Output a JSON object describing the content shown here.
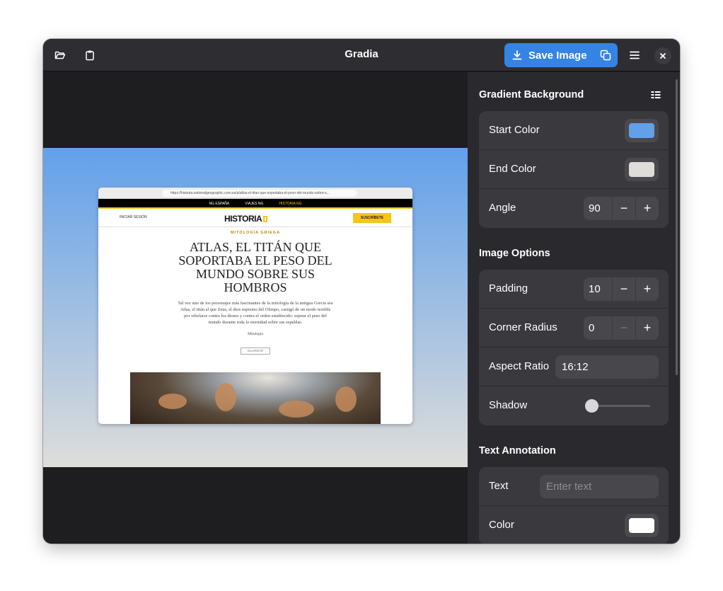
{
  "app": {
    "title": "Gradia"
  },
  "header": {
    "open_icon": "folder-open-icon",
    "paste_icon": "clipboard-icon",
    "save_label": "Save Image",
    "copy_icon": "copy-icon",
    "menu_icon": "hamburger-menu-icon",
    "close_icon": "close-icon"
  },
  "screenshot": {
    "url": "https://historia.nationalgeographic.com.es/a/atlas-el-titan-que-soportaba-el-peso-del-mundo-sobre-s...",
    "nav": [
      "NG ESPAÑA",
      "VIAJES NG",
      "HISTORIA NG"
    ],
    "login": "INICIAR SESIÓN",
    "logo": "HISTORIA",
    "logo_sub": "NATIONAL GEOGRAPHIC",
    "subscribe": "SUSCRÍBETE",
    "kicker": "MITOLOGÍA GRIEGA",
    "title": "ATLAS, EL TITÁN QUE SOPORTABA EL PESO DEL MUNDO SOBRE SUS HOMBROS",
    "dek": "Tal vez uno de los personajes más fascinantes de la mitología de la antigua Grecia sea Atlas, el titán al que Zeus, el dios supremo del Olimpo, castigó de un modo terrible por rebelarse contra los dioses y contra el orden establecido: sujetar el peso del mundo durante toda la eternidad sobre sus espaldas.",
    "tag": "Mitología",
    "save": "GUARDAR"
  },
  "sidebar": {
    "gradient": {
      "title": "Gradient Background",
      "presets_icon": "grid-presets-icon",
      "start_label": "Start Color",
      "start_color": "#62a0ea",
      "end_label": "End Color",
      "end_color": "#deddda",
      "angle_label": "Angle",
      "angle_value": "90"
    },
    "image_options": {
      "title": "Image Options",
      "padding_label": "Padding",
      "padding_value": "10",
      "radius_label": "Corner Radius",
      "radius_value": "0",
      "aspect_label": "Aspect Ratio",
      "aspect_value": "16:12",
      "shadow_label": "Shadow",
      "shadow_value": 0
    },
    "text_annotation": {
      "title": "Text Annotation",
      "text_label": "Text",
      "text_placeholder": "Enter text",
      "color_label": "Color",
      "color_value": "#ffffff"
    }
  }
}
